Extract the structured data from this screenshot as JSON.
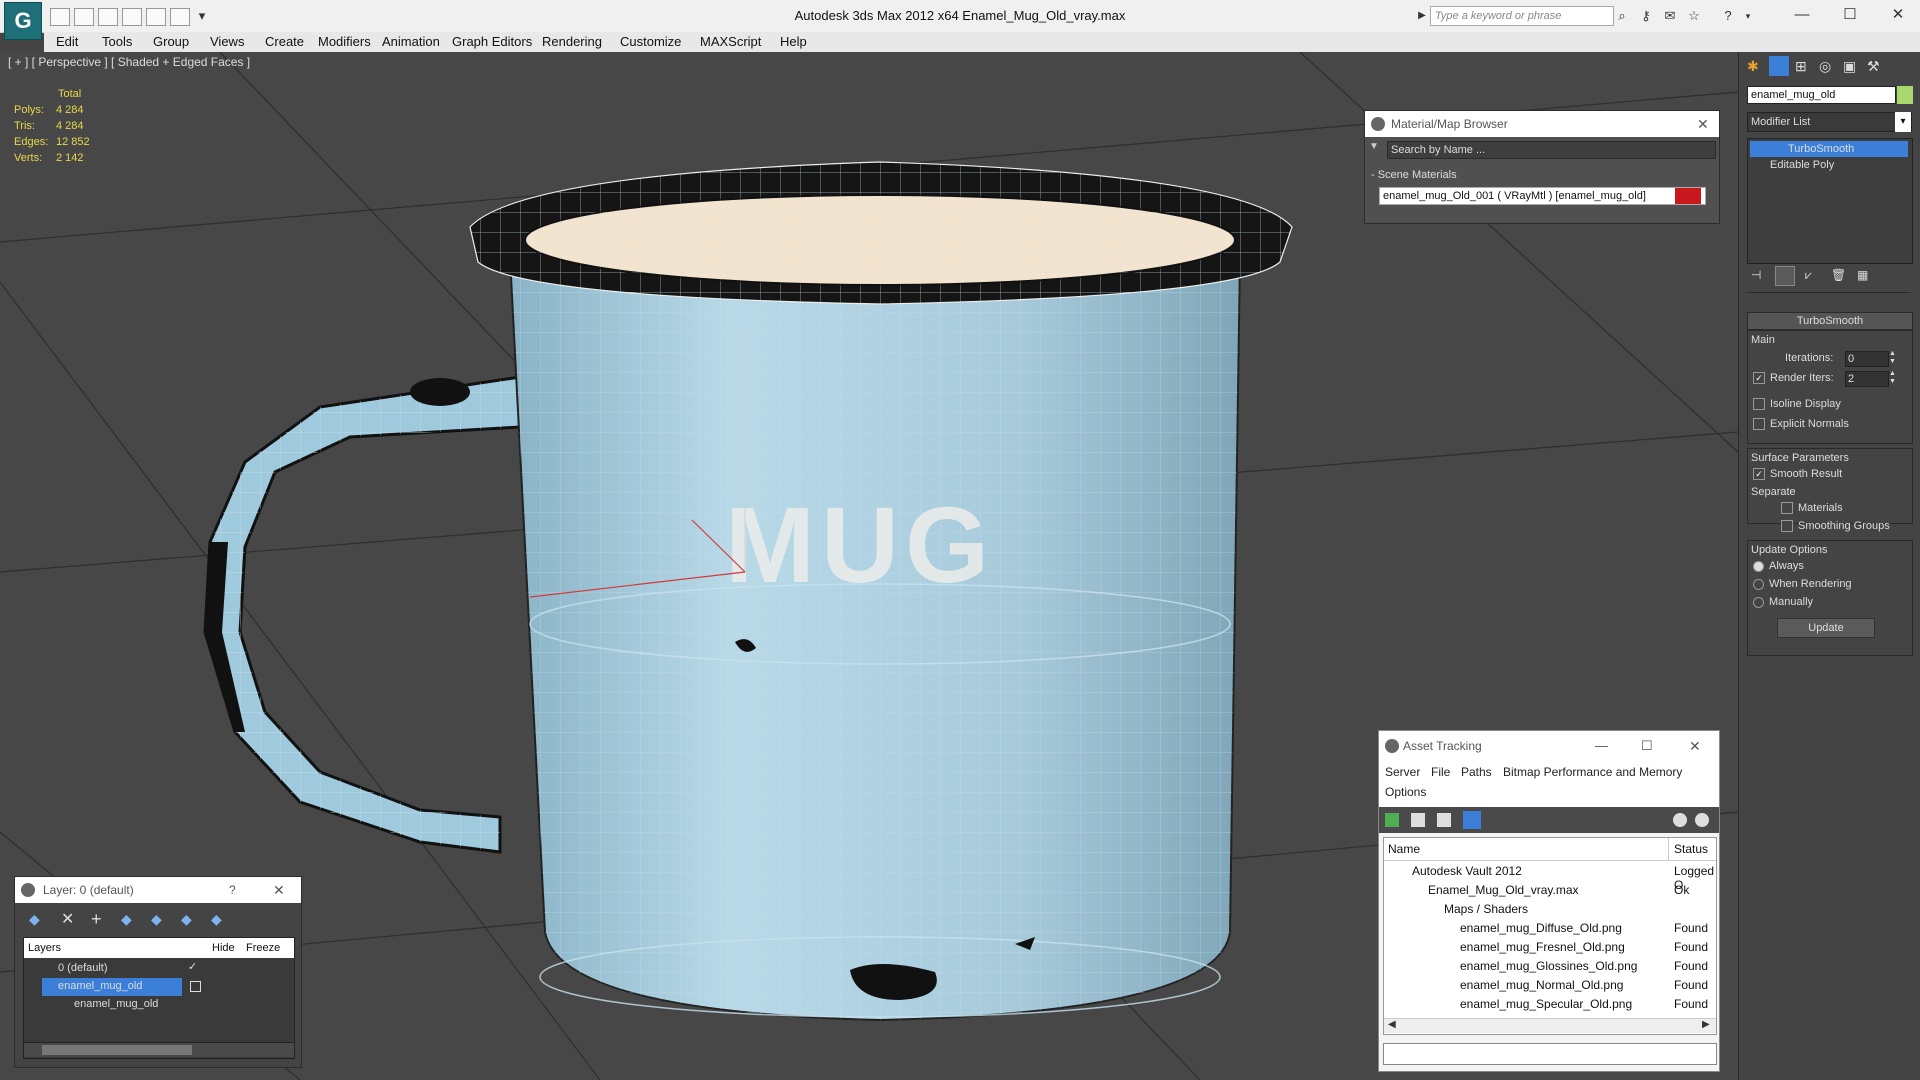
{
  "app": {
    "title": "Autodesk 3ds Max  2012 x64      Enamel_Mug_Old_vray.max",
    "search_placeholder": "Type a keyword or phrase"
  },
  "menu": [
    "Edit",
    "Tools",
    "Group",
    "Views",
    "Create",
    "Modifiers",
    "Animation",
    "Graph Editors",
    "Rendering",
    "Customize",
    "MAXScript",
    "Help"
  ],
  "viewport": {
    "label": "[ + ] [ Perspective ] [ Shaded + Edged Faces ]",
    "stats": {
      "header": "Total",
      "rows": [
        {
          "label": "Polys:",
          "value": "4 284"
        },
        {
          "label": "Tris:",
          "value": "4 284"
        },
        {
          "label": "Edges:",
          "value": "12 852"
        },
        {
          "label": "Verts:",
          "value": "2 142"
        }
      ]
    },
    "mug_text": "MUG"
  },
  "material_browser": {
    "title": "Material/Map Browser",
    "search_placeholder": "Search by Name ...",
    "section": "- Scene Materials",
    "item": "enamel_mug_Old_001  ( VRayMtl )  [enamel_mug_old]"
  },
  "asset_tracking": {
    "title": "Asset Tracking",
    "menu": [
      "Server",
      "File",
      "Paths",
      "Bitmap Performance and Memory"
    ],
    "menu2": "Options",
    "columns": {
      "name": "Name",
      "status": "Status"
    },
    "rows": [
      {
        "name": "Autodesk Vault 2012",
        "status": "Logged O"
      },
      {
        "name": "Enamel_Mug_Old_vray.max",
        "status": "Ok"
      },
      {
        "name": "Maps / Shaders",
        "status": ""
      },
      {
        "name": "enamel_mug_Diffuse_Old.png",
        "status": "Found"
      },
      {
        "name": "enamel_mug_Fresnel_Old.png",
        "status": "Found"
      },
      {
        "name": "enamel_mug_Glossines_Old.png",
        "status": "Found"
      },
      {
        "name": "enamel_mug_Normal_Old.png",
        "status": "Found"
      },
      {
        "name": "enamel_mug_Specular_Old.png",
        "status": "Found"
      }
    ]
  },
  "layer_panel": {
    "title": "Layer: 0 (default)",
    "help": "?",
    "columns": {
      "layers": "Layers",
      "hide": "Hide",
      "freeze": "Freeze"
    },
    "rows": [
      {
        "name": "0 (default)"
      },
      {
        "name": "enamel_mug_old"
      },
      {
        "name": "enamel_mug_old"
      }
    ]
  },
  "command_panel": {
    "object_name": "enamel_mug_old",
    "modifier_list": "Modifier List",
    "stack": [
      "TurboSmooth",
      "Editable Poly"
    ],
    "rollout_title": "TurboSmooth",
    "main_label": "Main",
    "iterations_label": "Iterations:",
    "iterations_value": "0",
    "render_iters_label": "Render Iters:",
    "render_iters_value": "2",
    "isoline": "Isoline Display",
    "explicit_normals": "Explicit Normals",
    "surface_params": "Surface Parameters",
    "smooth_result": "Smooth Result",
    "separate": "Separate",
    "materials": "Materials",
    "smoothing_groups": "Smoothing Groups",
    "update_options": "Update Options",
    "always": "Always",
    "when_rendering": "When Rendering",
    "manually": "Manually",
    "update_button": "Update"
  },
  "colors": {
    "object_color": "#a6d86e",
    "material_swatch": "#c8181e",
    "selection": "#3c7fd8",
    "stats_text": "#e8d84a",
    "mug_body": "#a9cedf"
  }
}
